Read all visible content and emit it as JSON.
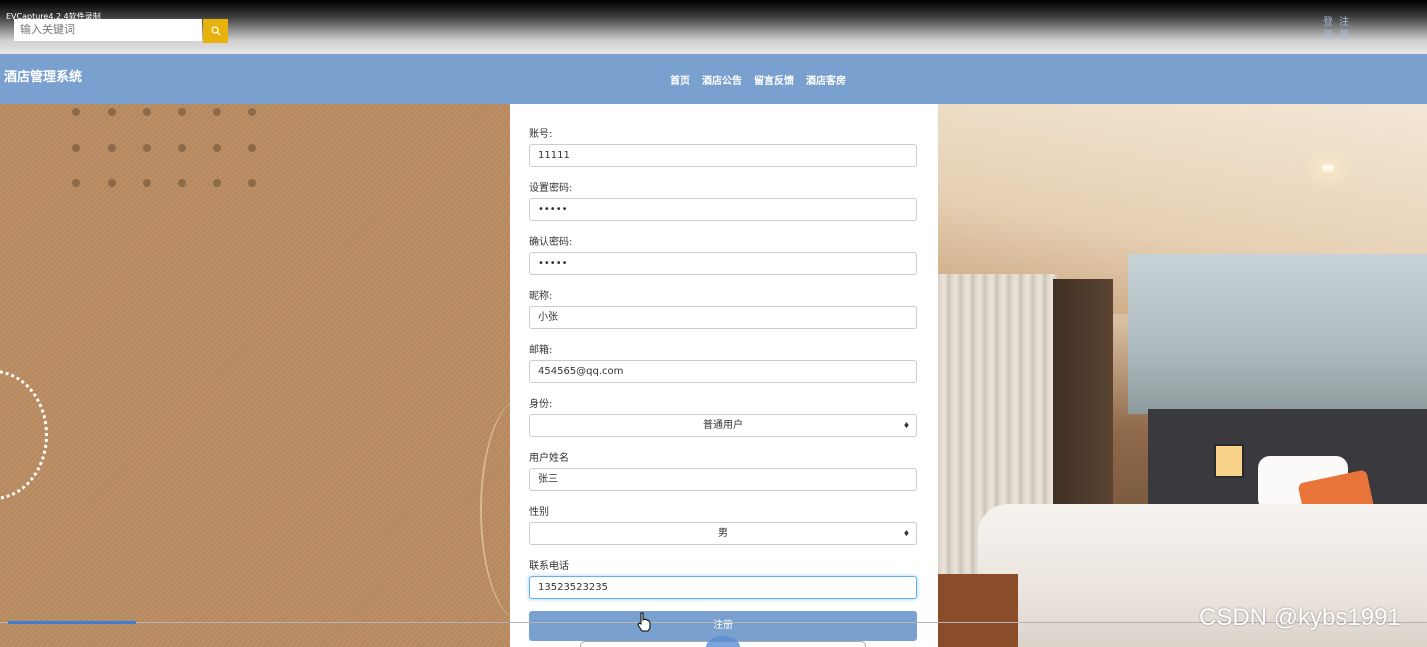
{
  "recorder_label": "EVCapture4.2.4软件录制",
  "search": {
    "placeholder": "输入关键词"
  },
  "top_links": {
    "login": "登录",
    "register": "注册"
  },
  "brand": "酒店管理系统",
  "nav": [
    "首页",
    "酒店公告",
    "留言反馈",
    "酒店客房"
  ],
  "form": {
    "account": {
      "label": "账号:",
      "value": "11111"
    },
    "password": {
      "label": "设置密码:",
      "value": "•••••"
    },
    "confirm_password": {
      "label": "确认密码:",
      "value": "•••••"
    },
    "nickname": {
      "label": "昵称:",
      "value": "小张"
    },
    "email": {
      "label": "邮箱:",
      "value": "454565@qq.com"
    },
    "identity": {
      "label": "身份:",
      "value": "普通用户"
    },
    "real_name": {
      "label": "用户姓名",
      "value": "张三"
    },
    "gender": {
      "label": "性别",
      "value": "男"
    },
    "phone": {
      "label": "联系电话",
      "value": "13523523235"
    },
    "submit_label": "注册"
  },
  "watermark": "CSDN @kybs1991",
  "icons": {
    "search": "search-icon",
    "select_caret": "updown-caret-icon",
    "cursor": "hand-pointer-icon"
  },
  "colors": {
    "nav_bg": "#7aa0cf",
    "search_btn": "#e8b20c",
    "button": "#7aa0cf"
  },
  "video_progress": 0.09
}
